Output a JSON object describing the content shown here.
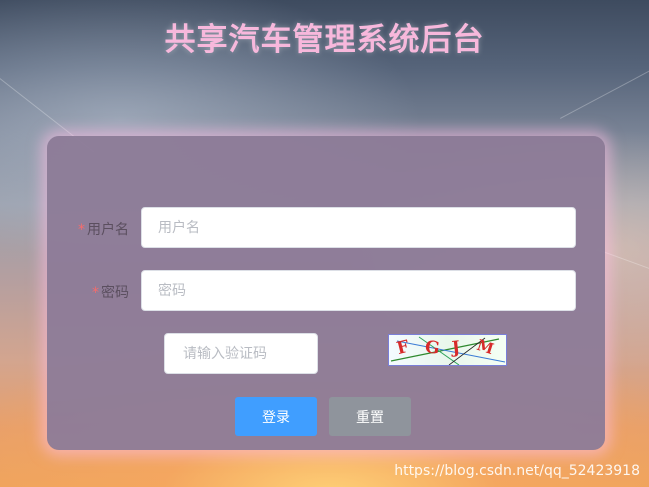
{
  "page": {
    "title": "共享汽车管理系统后台"
  },
  "login_form": {
    "required_mark": "*",
    "username_label": "用户名",
    "username_placeholder": "用户名",
    "username_value": "",
    "password_label": "密码",
    "password_placeholder": "密码",
    "password_value": "",
    "captcha_placeholder": "请输入验证码",
    "captcha_value": "",
    "captcha_image_text": [
      "F",
      "G",
      "J",
      "M"
    ],
    "login_button": "登录",
    "reset_button": "重置"
  },
  "watermark": "https://blog.csdn.net/qq_52423918",
  "colors": {
    "title": "#f7b8dc",
    "panel": "#8e7c98",
    "login_button": "#409eff",
    "reset_button": "#8f949c",
    "required_mark": "#f56c6c"
  }
}
